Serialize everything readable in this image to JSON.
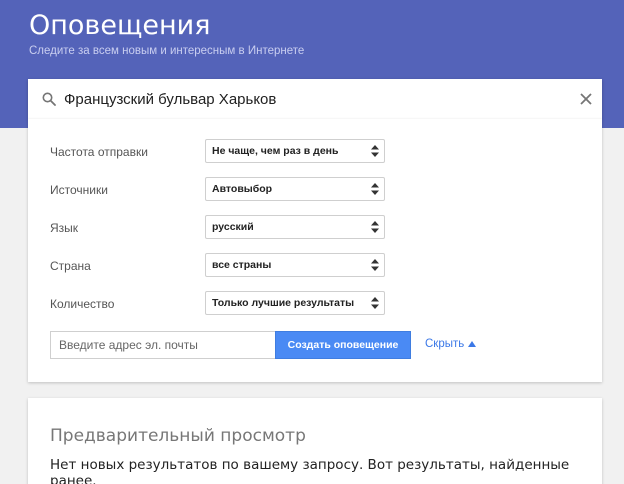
{
  "header": {
    "title": "Оповещения",
    "subtitle": "Следите за всем новым и интересным в Интернете"
  },
  "search": {
    "value": "Французский бульвар Харьков",
    "icon": "search-icon",
    "clear_icon": "close-icon"
  },
  "options": [
    {
      "label": "Частота отправки",
      "value": "Не чаще, чем раз в день"
    },
    {
      "label": "Источники",
      "value": "Автовыбор"
    },
    {
      "label": "Язык",
      "value": "русский"
    },
    {
      "label": "Страна",
      "value": "все страны"
    },
    {
      "label": "Количество",
      "value": "Только лучшие результаты"
    }
  ],
  "email": {
    "placeholder": "Введите адрес эл. почты"
  },
  "create_button": "Создать оповещение",
  "hide_link": "Скрыть",
  "preview": {
    "title": "Предварительный просмотр",
    "message": "Нет новых результатов по вашему запросу. Вот результаты, найденные ранее."
  },
  "colors": {
    "header": "#5463b9",
    "button": "#4a8af4",
    "link": "#3b78e7"
  }
}
